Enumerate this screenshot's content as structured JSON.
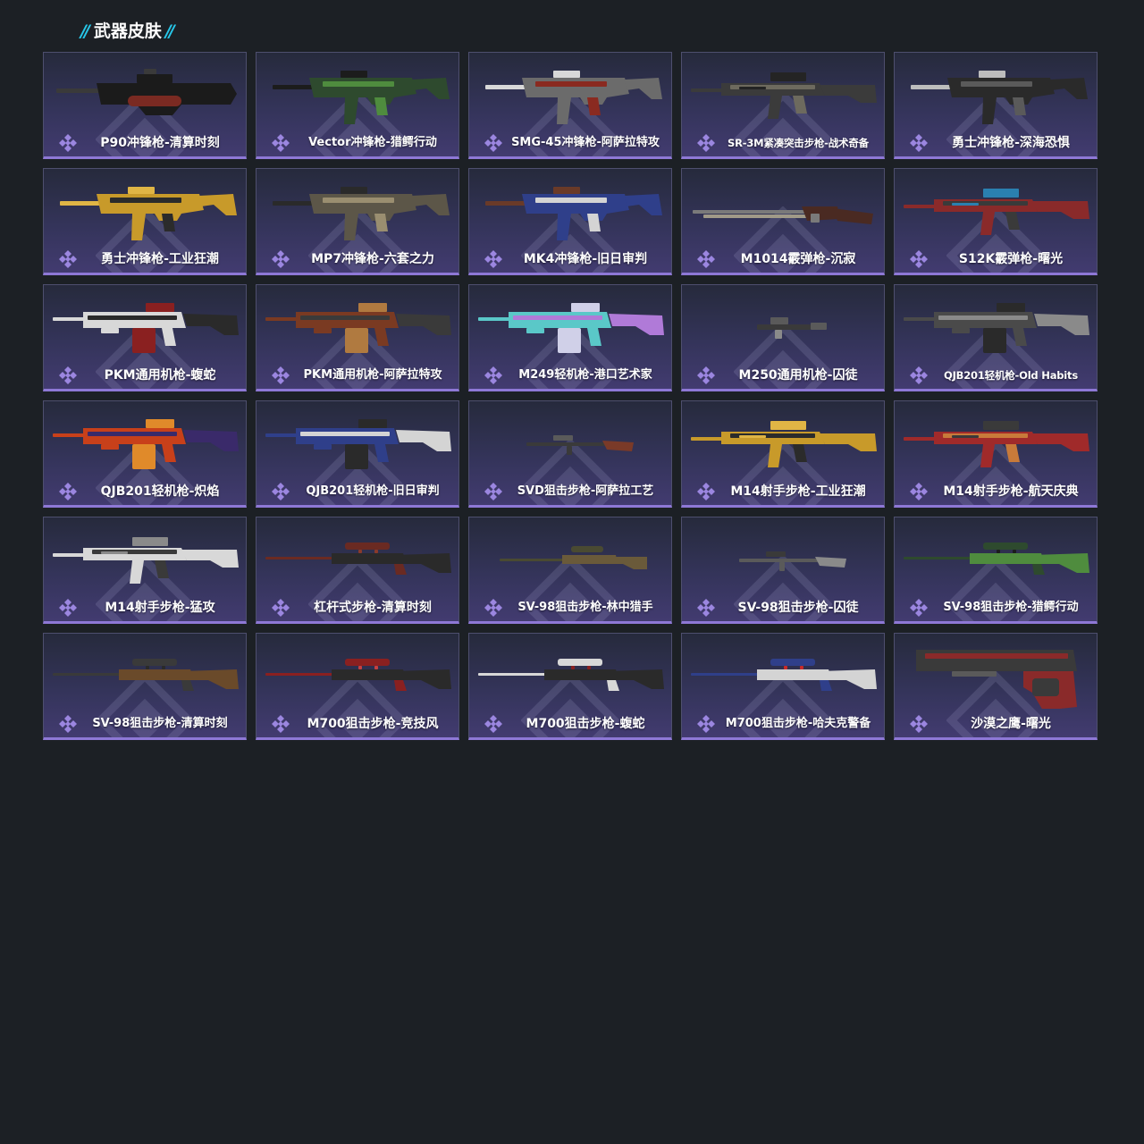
{
  "section": {
    "title": "武器皮肤",
    "accent_color": "#27c6e8"
  },
  "colors": {
    "background": "#1c2025",
    "card_bottom_border": "#8e78d6",
    "rarity_icon": "#9b86e0"
  },
  "skins": [
    {
      "name": "P90冲锋枪-清算时刻",
      "icon": "weapon-image",
      "palette": [
        "#1b1b1b",
        "#7a2a22",
        "#3a3a3a"
      ],
      "shape": "bullpup"
    },
    {
      "name": "Vector冲锋枪-猎鳄行动",
      "icon": "weapon-image",
      "palette": [
        "#2e4a2e",
        "#4f8c3e",
        "#1c1c1c"
      ],
      "shape": "smg"
    },
    {
      "name": "SMG-45冲锋枪-阿萨拉特攻",
      "icon": "weapon-image",
      "palette": [
        "#6b6b6b",
        "#8a2a20",
        "#d8d8d8"
      ],
      "shape": "smg"
    },
    {
      "name": "SR-3M紧凑突击步枪-战术奇备",
      "icon": "weapon-image",
      "palette": [
        "#3b3b3b",
        "#6d6a5e",
        "#242424"
      ],
      "shape": "rifle"
    },
    {
      "name": "勇士冲锋枪-深海恐惧",
      "icon": "weapon-image",
      "palette": [
        "#2a2a2a",
        "#5a5a5a",
        "#bdbdbd"
      ],
      "shape": "smg"
    },
    {
      "name": "勇士冲锋枪-工业狂潮",
      "icon": "weapon-image",
      "palette": [
        "#c89a2a",
        "#2b2b2b",
        "#e0b545"
      ],
      "shape": "smg"
    },
    {
      "name": "MP7冲锋枪-六套之力",
      "icon": "weapon-image",
      "palette": [
        "#5c5648",
        "#9a8e70",
        "#2a2a2a"
      ],
      "shape": "smg"
    },
    {
      "name": "MK4冲锋枪-旧日审判",
      "icon": "weapon-image",
      "palette": [
        "#2f3f8a",
        "#d4d4d4",
        "#6a3a28"
      ],
      "shape": "smg"
    },
    {
      "name": "M1014霰弹枪-沉寂",
      "icon": "weapon-image",
      "palette": [
        "#7a7a7a",
        "#a09a88",
        "#4a2a22"
      ],
      "shape": "shotgun"
    },
    {
      "name": "S12K霰弹枪-曙光",
      "icon": "weapon-image",
      "palette": [
        "#8a2a2a",
        "#3a3a3a",
        "#2a80b0"
      ],
      "shape": "rifle"
    },
    {
      "name": "PKM通用机枪-蝮蛇",
      "icon": "weapon-image",
      "palette": [
        "#d8d8d8",
        "#2a2a2a",
        "#8a2020"
      ],
      "shape": "lmg"
    },
    {
      "name": "PKM通用机枪-阿萨拉特攻",
      "icon": "weapon-image",
      "palette": [
        "#7a3a22",
        "#3a3a3a",
        "#b07a40"
      ],
      "shape": "lmg"
    },
    {
      "name": "M249轻机枪-港口艺术家",
      "icon": "weapon-image",
      "palette": [
        "#5ac8c8",
        "#b07ad8",
        "#d0d0e8"
      ],
      "shape": "lmg"
    },
    {
      "name": "M250通用机枪-囚徒",
      "icon": "weapon-image",
      "palette": [
        "#3a3a3a",
        "#5a5a5a",
        "#8a8a8a"
      ],
      "shape": "tiny"
    },
    {
      "name": "QJB201轻机枪-Old Habits",
      "icon": "weapon-image",
      "palette": [
        "#4a4a4a",
        "#8a8a8a",
        "#2a2a2a"
      ],
      "shape": "lmg"
    },
    {
      "name": "QJB201轻机枪-炽焰",
      "icon": "weapon-image",
      "palette": [
        "#c8401a",
        "#3a2a6a",
        "#e08a2a"
      ],
      "shape": "lmg"
    },
    {
      "name": "QJB201轻机枪-旧日审判",
      "icon": "weapon-image",
      "palette": [
        "#2f3f8a",
        "#d4d4d4",
        "#2a2a2a"
      ],
      "shape": "lmg"
    },
    {
      "name": "SVD狙击步枪-阿萨拉工艺",
      "icon": "weapon-image",
      "palette": [
        "#3a3a3a",
        "#7a3a28",
        "#5a5a5a"
      ],
      "shape": "tiny-rifle"
    },
    {
      "name": "M14射手步枪-工业狂潮",
      "icon": "weapon-image",
      "palette": [
        "#c89a2a",
        "#2b2b2b",
        "#e0b545"
      ],
      "shape": "rifle"
    },
    {
      "name": "M14射手步枪-航天庆典",
      "icon": "weapon-image",
      "palette": [
        "#a02a2a",
        "#c87a3a",
        "#3a3a3a"
      ],
      "shape": "rifle"
    },
    {
      "name": "M14射手步枪-猛攻",
      "icon": "weapon-image",
      "palette": [
        "#d8d8d8",
        "#3a3a3a",
        "#8a8a8a"
      ],
      "shape": "rifle"
    },
    {
      "name": "杠杆式步枪-清算时刻",
      "icon": "weapon-image",
      "palette": [
        "#6a2a22",
        "#2a2a2a",
        "#8a3a2a"
      ],
      "shape": "sniper"
    },
    {
      "name": "SV-98狙击步枪-林中猎手",
      "icon": "weapon-image",
      "palette": [
        "#4a4a32",
        "#6a5a3a",
        "#2a2a2a"
      ],
      "shape": "sniper-small"
    },
    {
      "name": "SV-98狙击步枪-囚徒",
      "icon": "weapon-image",
      "palette": [
        "#5a5a5a",
        "#8a8a8a",
        "#3a3a3a"
      ],
      "shape": "tiny-rifle"
    },
    {
      "name": "SV-98狙击步枪-猎鳄行动",
      "icon": "weapon-image",
      "palette": [
        "#2e4a2e",
        "#4f8c3e",
        "#1c1c1c"
      ],
      "shape": "sniper"
    },
    {
      "name": "SV-98狙击步枪-清算时刻",
      "icon": "weapon-image",
      "palette": [
        "#3a3a3a",
        "#6a4a2a",
        "#2a2a2a"
      ],
      "shape": "sniper"
    },
    {
      "name": "M700狙击步枪-竞技风",
      "icon": "weapon-image",
      "palette": [
        "#8a2020",
        "#2a2a2a",
        "#c84040"
      ],
      "shape": "sniper"
    },
    {
      "name": "M700狙击步枪-蝮蛇",
      "icon": "weapon-image",
      "palette": [
        "#d8d8d8",
        "#2a2a2a",
        "#8a2020"
      ],
      "shape": "sniper"
    },
    {
      "name": "M700狙击步枪-哈夫克警备",
      "icon": "weapon-image",
      "palette": [
        "#2f3f8a",
        "#d4d4d4",
        "#c82a2a"
      ],
      "shape": "sniper"
    },
    {
      "name": "沙漠之鹰-曙光",
      "icon": "weapon-image",
      "palette": [
        "#3a3a3a",
        "#8a2a2a",
        "#5a5a5a"
      ],
      "shape": "pistol"
    }
  ]
}
